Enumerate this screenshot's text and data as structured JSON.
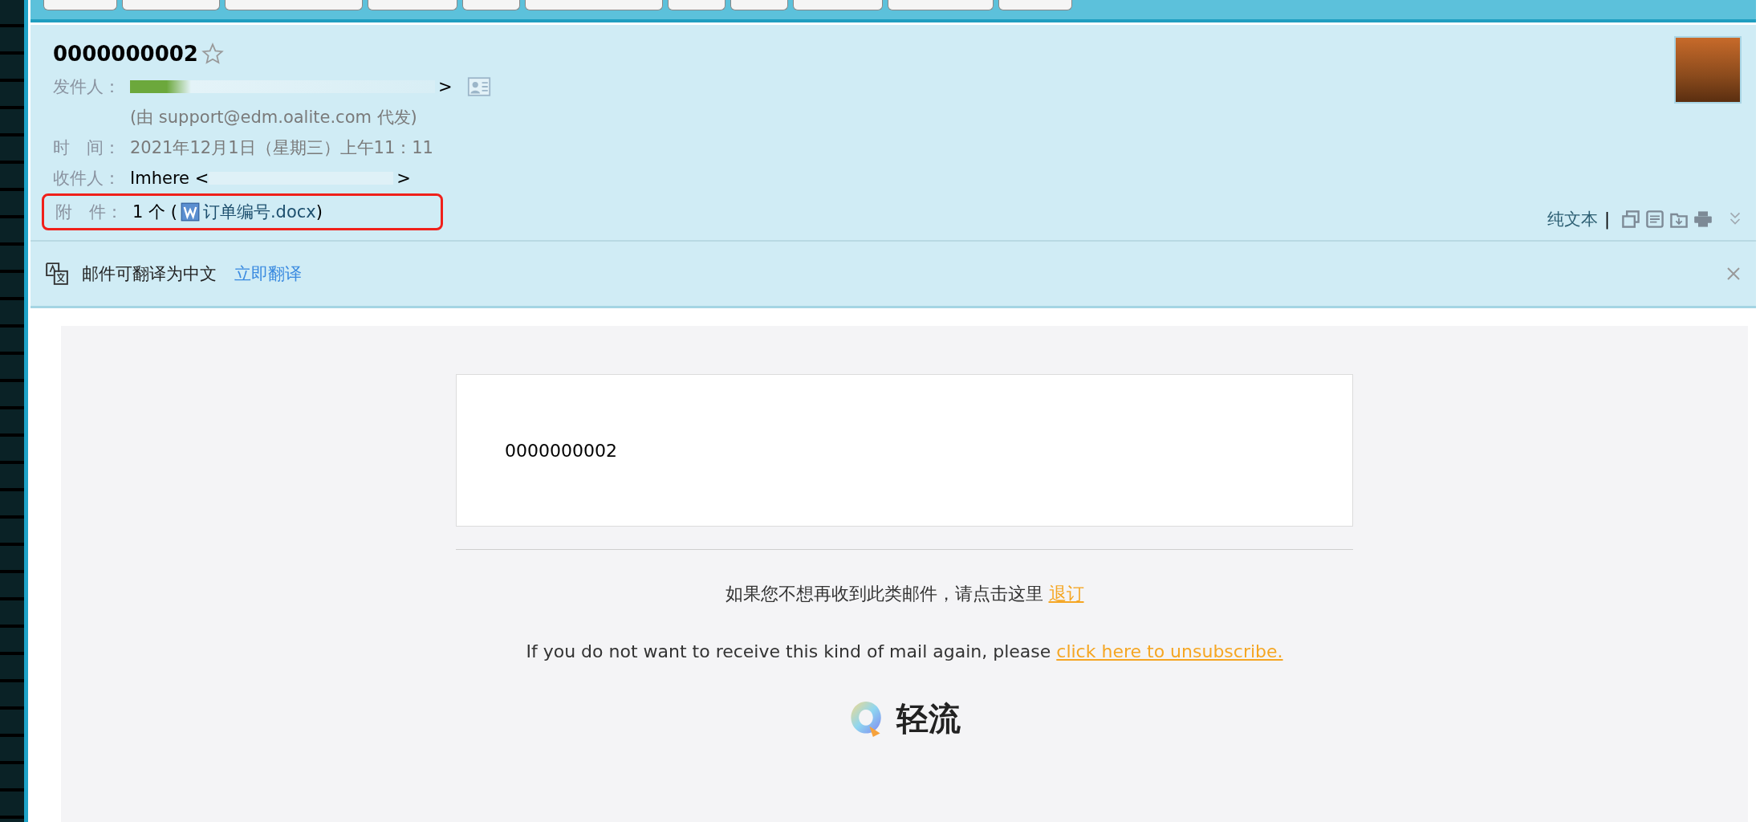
{
  "email": {
    "subject": "0000000002",
    "starred": false,
    "fields": [
      {
        "kind": "sender",
        "label": "发件人：",
        "tail": ">",
        "note": "(由 support@edm.oalite.com 代发)"
      },
      {
        "kind": "text",
        "label": "时　间：",
        "value": "2021年12月1日（星期三）上午11：11"
      },
      {
        "kind": "recipient",
        "label": "收件人：",
        "value": "Imhere <",
        "tail": ">"
      },
      {
        "kind": "attachment",
        "label": "附　件：",
        "count": "1 个 (",
        "file": "订单编号.docx",
        "close": ")",
        "highlighted": true
      }
    ],
    "view_link": "纯文本",
    "separator": "|"
  },
  "translate_bar": {
    "message": "邮件可翻译为中文",
    "action": "立即翻译"
  },
  "body": {
    "card_text": "0000000002",
    "unsubscribe_cn": {
      "text": "如果您不想再收到此类邮件，请点击这里 ",
      "link": "退订"
    },
    "unsubscribe_en": {
      "text": "If you do not want to receive this kind of mail again, please ",
      "link": "click here to unsubscribe."
    },
    "brand": "轻流"
  }
}
